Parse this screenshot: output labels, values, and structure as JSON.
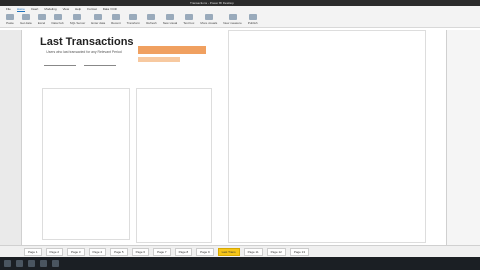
{
  "window": {
    "title": "Transactions - Power BI Desktop"
  },
  "ribbon": {
    "tabs": [
      "File",
      "Home",
      "Insert",
      "Modeling",
      "View",
      "Help",
      "Format",
      "Data / Drill"
    ],
    "buttons": [
      "Paste",
      "Get data",
      "Excel",
      "Data hub",
      "SQL Server",
      "Enter data",
      "Recent",
      "Transform",
      "Refresh",
      "New visual",
      "Text box",
      "More visuals",
      "New measure",
      "Publish"
    ]
  },
  "report": {
    "title": "Last Transactions",
    "subtitle": "Users who last transacted for any Relevant Period"
  },
  "pagebar": {
    "tabs": [
      "Page 1",
      "Page 2",
      "Page 3",
      "Page 4",
      "Page 5",
      "Page 6",
      "Page 7",
      "Page 8",
      "Page 9",
      "Last Trans",
      "Page 11",
      "Page 12",
      "Page 13"
    ],
    "active": "Last Trans"
  },
  "colors": {
    "accent": "#f5c518",
    "bar": "#f0a060",
    "teal": "#7ecbc0"
  }
}
